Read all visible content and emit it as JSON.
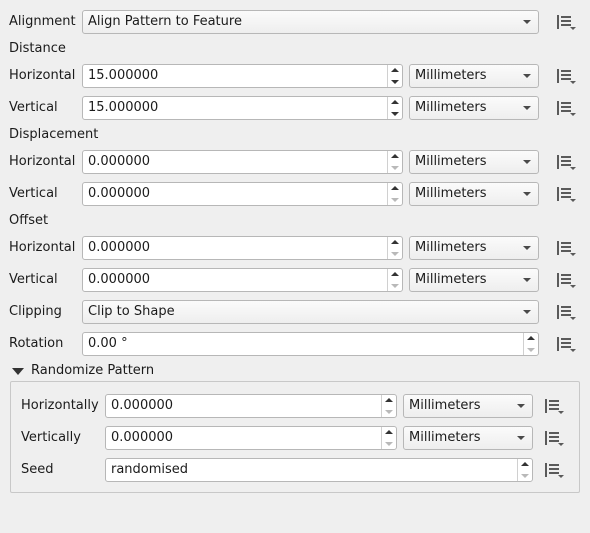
{
  "alignment": {
    "label": "Alignment",
    "value": "Align Pattern to Feature"
  },
  "distance": {
    "header": "Distance",
    "horizontal": {
      "label": "Horizontal",
      "value": "15.000000",
      "unit": "Millimeters"
    },
    "vertical": {
      "label": "Vertical",
      "value": "15.000000",
      "unit": "Millimeters"
    }
  },
  "displacement": {
    "header": "Displacement",
    "horizontal": {
      "label": "Horizontal",
      "value": "0.000000",
      "unit": "Millimeters"
    },
    "vertical": {
      "label": "Vertical",
      "value": "0.000000",
      "unit": "Millimeters"
    }
  },
  "offset": {
    "header": "Offset",
    "horizontal": {
      "label": "Horizontal",
      "value": "0.000000",
      "unit": "Millimeters"
    },
    "vertical": {
      "label": "Vertical",
      "value": "0.000000",
      "unit": "Millimeters"
    }
  },
  "clipping": {
    "label": "Clipping",
    "value": "Clip to Shape"
  },
  "rotation": {
    "label": "Rotation",
    "value": "0.00 °"
  },
  "randomize": {
    "title": "Randomize Pattern",
    "expanded": true,
    "horizontally": {
      "label": "Horizontally",
      "value": "0.000000",
      "unit": "Millimeters"
    },
    "vertically": {
      "label": "Vertically",
      "value": "0.000000",
      "unit": "Millimeters"
    },
    "seed": {
      "label": "Seed",
      "value": "randomised"
    }
  },
  "icons": {
    "data_defined": "data-defined-override-icon",
    "combo_arrow": "chevron-down-icon",
    "spin_up": "spin-up-icon",
    "spin_down": "spin-down-icon",
    "expand": "triangle-down-icon"
  },
  "colors": {
    "background": "#efefef",
    "field": "#ffffff",
    "border": "#b7b7b7",
    "icon": "#555555"
  }
}
